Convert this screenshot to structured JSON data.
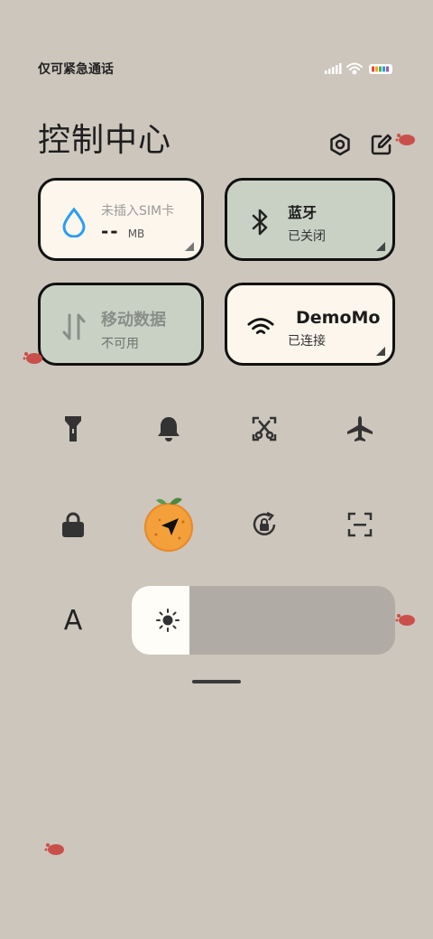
{
  "status_bar": {
    "carrier_text": "仅可紧急通话",
    "icons": [
      "signal-icon",
      "wifi-icon",
      "battery-icon"
    ]
  },
  "header": {
    "title": "控制中心",
    "settings_icon": "gear-icon",
    "edit_icon": "edit-icon"
  },
  "tiles": {
    "data_usage": {
      "label": "未插入SIM卡",
      "value": "--",
      "unit": "MB",
      "icon": "water-drop-icon"
    },
    "bluetooth": {
      "label": "蓝牙",
      "status": "已关闭",
      "icon": "bluetooth-icon"
    },
    "mobile_data": {
      "label": "移动数据",
      "status": "不可用",
      "icon": "mobile-data-icon"
    },
    "wifi": {
      "label": "DemoMo",
      "status": "已连接",
      "icon": "wifi-icon"
    }
  },
  "quick_toggles_row1": [
    "flashlight-icon",
    "bell-icon",
    "screenshot-icon",
    "airplane-icon"
  ],
  "quick_toggles_row2": [
    "lock-icon",
    "location-icon",
    "rotation-lock-icon",
    "scan-icon"
  ],
  "font_toggle": {
    "label": "A"
  },
  "brightness": {
    "level": 0.22,
    "icon": "brightness-icon"
  },
  "colors": {
    "background": "#ccc6bd",
    "tile_on": "#fdf6ec",
    "tile_off": "#c9d1c5",
    "accent_blue": "#2a9df4"
  }
}
